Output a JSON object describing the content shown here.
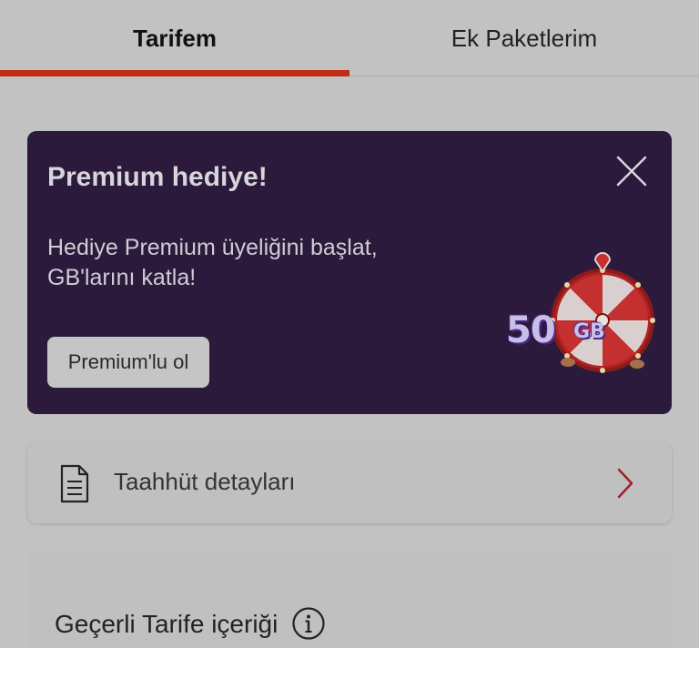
{
  "tabs": [
    {
      "label": "Tarifem",
      "active": true
    },
    {
      "label": "Ek Paketlerim",
      "active": false
    }
  ],
  "accent_color": "#c22b14",
  "promo": {
    "title": "Premium hediye!",
    "description_line1": "Hediye Premium üyeliğini başlat,",
    "description_line2": "GB'larını katla!",
    "button_label": "Premium'lu ol",
    "visual_amount": "50",
    "visual_unit": "GB",
    "icons": {
      "close": "close-icon",
      "wheel": "prize-wheel-icon"
    }
  },
  "commitment": {
    "label": "Taahhüt detayları",
    "icons": {
      "leading": "document-icon",
      "trailing": "chevron-right-icon"
    }
  },
  "tariff": {
    "label": "Geçerli Tarife içeriği",
    "icons": {
      "info": "info-icon"
    }
  }
}
